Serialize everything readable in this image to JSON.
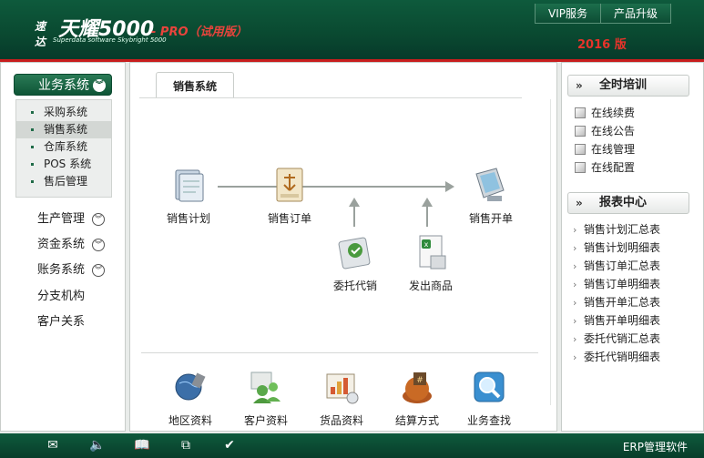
{
  "header": {
    "logo_small": "速达",
    "logo_big": "天耀5000",
    "logo_edition": "- PRO（试用版）",
    "logo_english": "Superdata software Skybright 5000",
    "buttons": [
      "VIP服务",
      "产品升级"
    ],
    "year": "2016 版"
  },
  "sidebar": {
    "active_category": "业务系统",
    "submenu": [
      "采购系统",
      "销售系统",
      "仓库系统",
      "POS 系统",
      "售后管理"
    ],
    "selected_sub": "销售系统",
    "categories": [
      "生产管理",
      "资金系统",
      "账务系统",
      "分支机构",
      "客户关系"
    ]
  },
  "main": {
    "tab": "销售系统",
    "flow": {
      "plan": "销售计划",
      "order": "销售订单",
      "invoice": "销售开单",
      "consign": "委托代销",
      "ship": "发出商品"
    },
    "bottom": [
      "地区资料",
      "客户资料",
      "货品资料",
      "结算方式",
      "业务查找"
    ]
  },
  "right": {
    "training": {
      "title": "全时培训",
      "items": [
        "在线续费",
        "在线公告",
        "在线管理",
        "在线配置"
      ]
    },
    "reports": {
      "title": "报表中心",
      "items": [
        "销售计划汇总表",
        "销售计划明细表",
        "销售订单汇总表",
        "销售订单明细表",
        "销售开单汇总表",
        "销售开单明细表",
        "委托代销汇总表",
        "委托代销明细表"
      ]
    }
  },
  "footer": {
    "icons": [
      "mail-icon",
      "speaker-icon",
      "book-icon",
      "copy-icon",
      "check-icon"
    ],
    "text": "ERP管理软件"
  },
  "colors": {
    "brand_green": "#0e5a3c",
    "accent_red": "#e8332a"
  }
}
